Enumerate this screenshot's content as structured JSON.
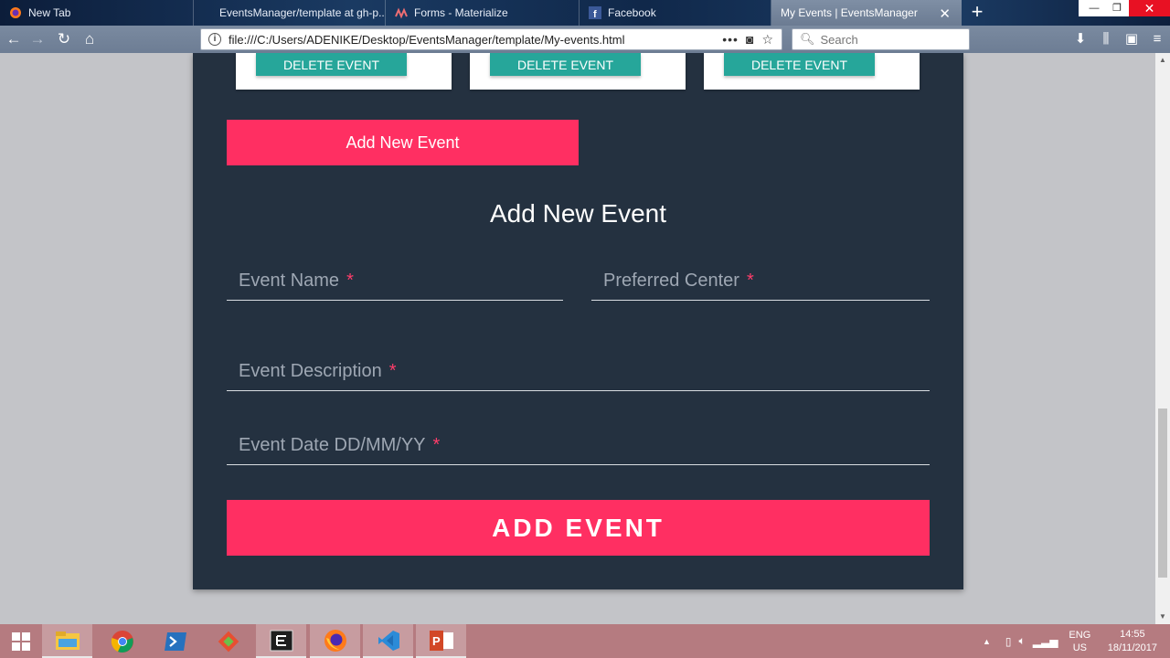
{
  "browser": {
    "tabs": [
      {
        "title": "New Tab",
        "icon": "firefox-icon"
      },
      {
        "title": "EventsManager/template at gh-p...",
        "icon": "github-icon"
      },
      {
        "title": "Forms - Materialize",
        "icon": "materialize-icon"
      },
      {
        "title": "Facebook",
        "icon": "facebook-icon"
      },
      {
        "title": "My Events | EventsManager",
        "icon": "page-icon"
      }
    ],
    "url": "file:///C:/Users/ADENIKE/Desktop/EventsManager/template/My-events.html",
    "search_placeholder": "Search"
  },
  "page": {
    "cards": [
      {
        "delete_label": "DELETE EVENT"
      },
      {
        "delete_label": "DELETE EVENT"
      },
      {
        "delete_label": "DELETE EVENT"
      }
    ],
    "add_new_button": "Add New Event",
    "form": {
      "title": "Add New Event",
      "fields": {
        "event_name": "Event Name",
        "preferred_center": "Preferred Center",
        "event_description": "Event Description",
        "event_date": "Event Date DD/MM/YY"
      },
      "required_mark": "*",
      "submit_label": "ADD EVENT"
    }
  },
  "taskbar": {
    "apps": [
      "file-explorer-icon",
      "chrome-icon",
      "powershell-icon",
      "git-icon",
      "terminal-icon",
      "firefox-icon",
      "vscode-icon",
      "powerpoint-icon"
    ],
    "lang_top": "ENG",
    "lang_bottom": "US",
    "time": "14:55",
    "date": "18/11/2017"
  },
  "colors": {
    "panel_bg": "#243140",
    "accent_pink": "#ff2f62",
    "teal": "#26a69a",
    "page_bg": "#c3c4c8"
  }
}
